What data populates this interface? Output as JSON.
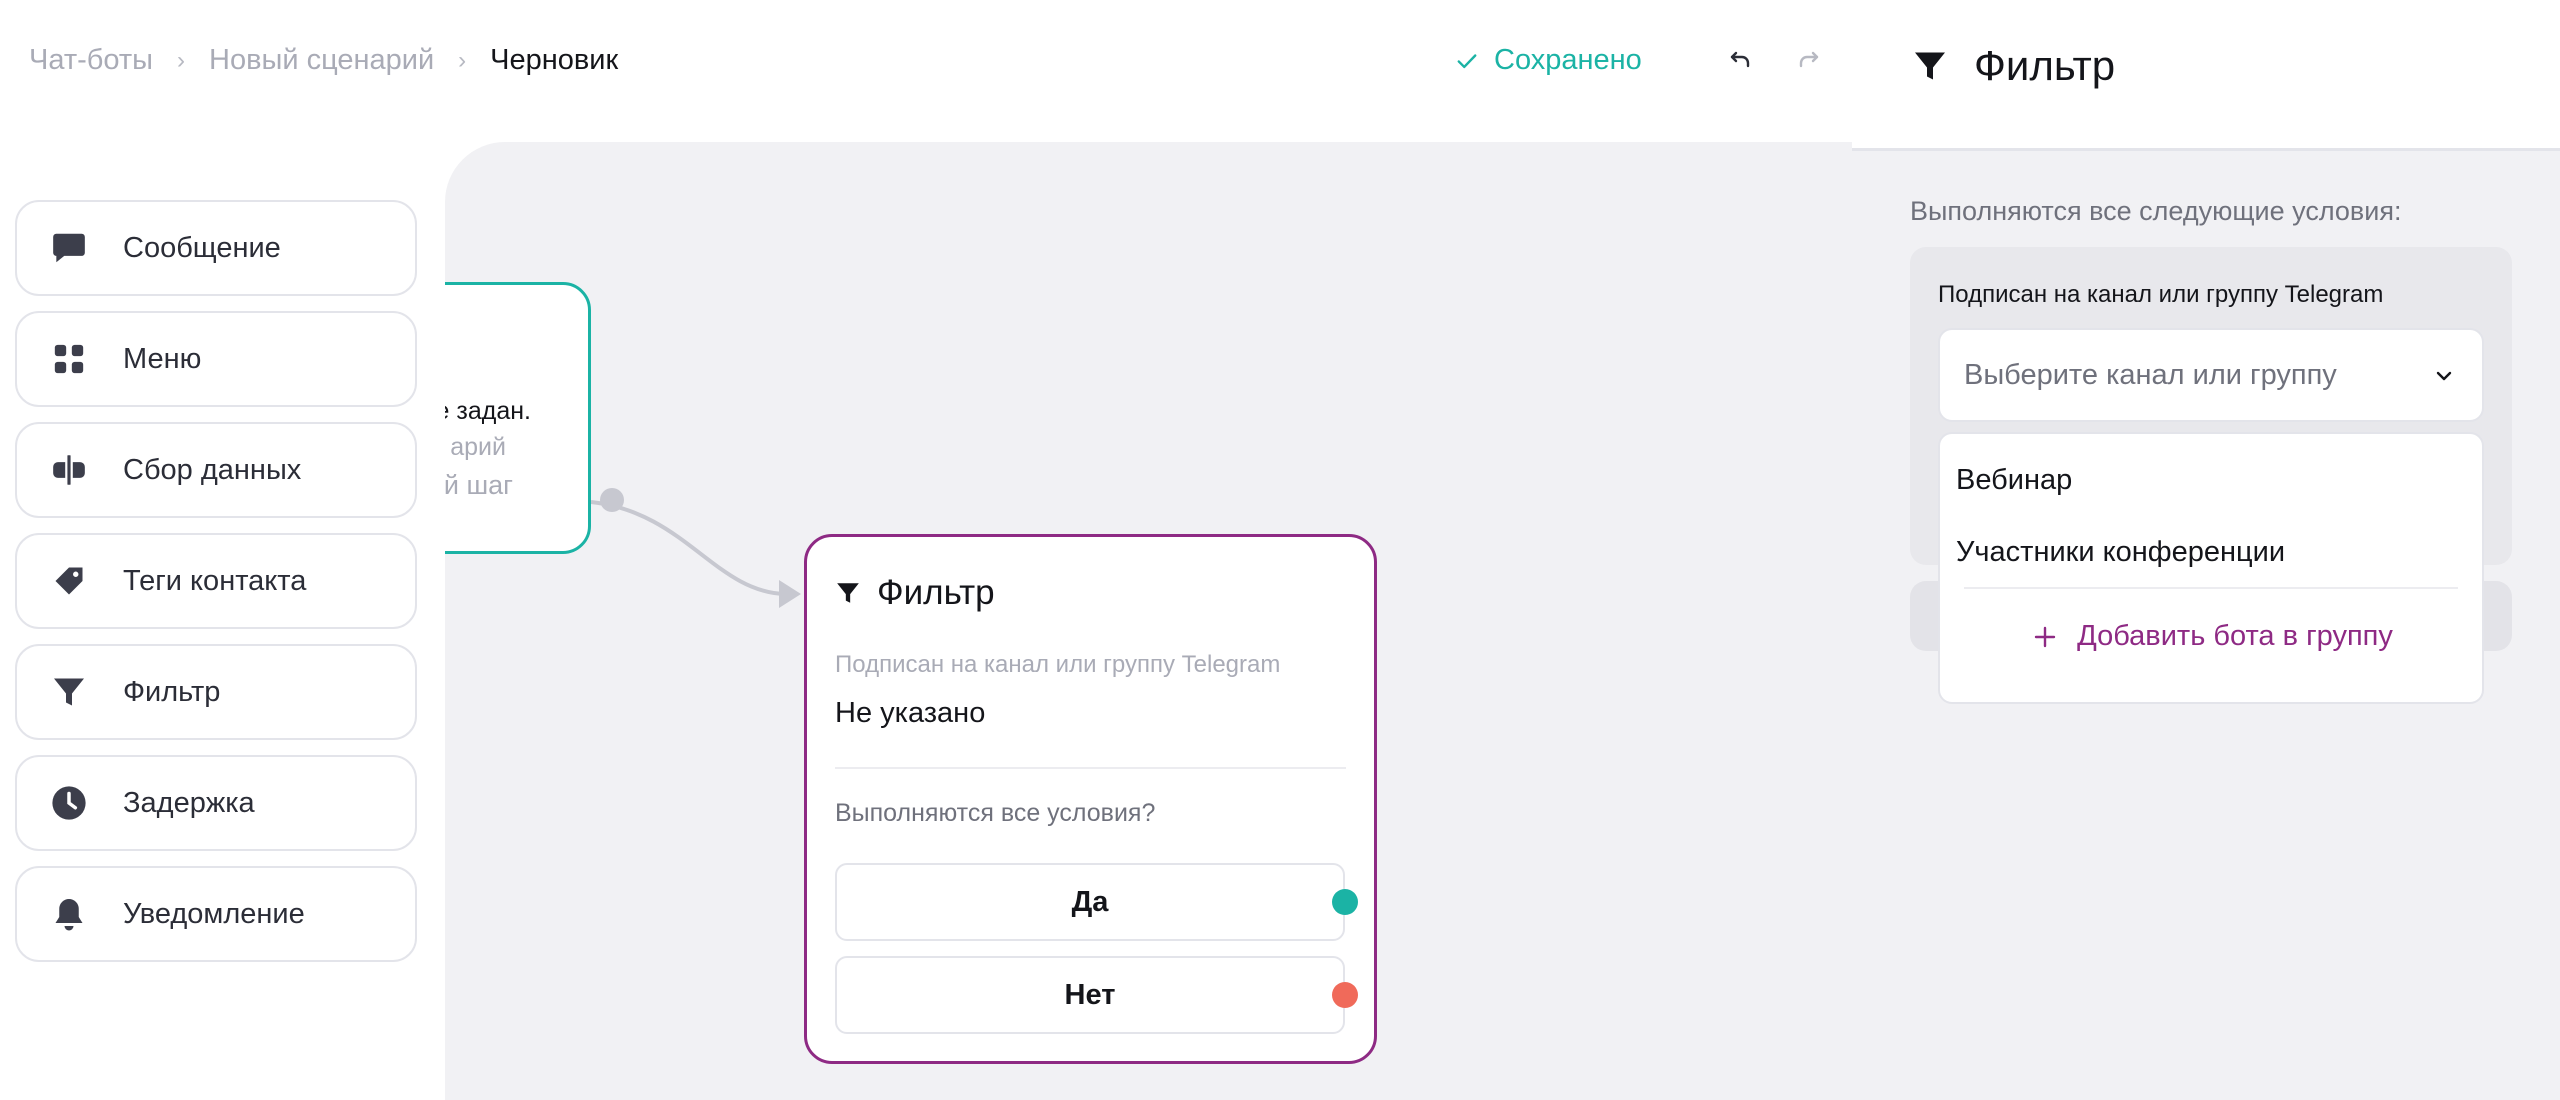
{
  "breadcrumb": {
    "items": [
      "Чат-боты",
      "Новый сценарий",
      "Черновик"
    ],
    "separator": "›"
  },
  "status": {
    "saved_label": "Сохранено",
    "color": "#1bb3a5"
  },
  "toolbar": {
    "undo_icon": "undo-icon",
    "redo_icon": "redo-icon"
  },
  "palette": {
    "items": [
      {
        "label": "Сообщение",
        "icon": "message-icon"
      },
      {
        "label": "Меню",
        "icon": "grid-icon"
      },
      {
        "label": "Сбор данных",
        "icon": "text-cursor-icon"
      },
      {
        "label": "Теги контакта",
        "icon": "tag-icon"
      },
      {
        "label": "Фильтр",
        "icon": "filter-icon"
      },
      {
        "label": "Задержка",
        "icon": "clock-icon"
      },
      {
        "label": "Уведомление",
        "icon": "bell-icon"
      }
    ]
  },
  "canvas": {
    "prev_node": {
      "line1": "е задан.",
      "line2": "арий",
      "line3": "й шаг"
    },
    "filter_node": {
      "title": "Фильтр",
      "condition_label": "Подписан на канал или группу Telegram",
      "condition_value": "Не указано",
      "question": "Выполняются все условия?",
      "yes_label": "Да",
      "no_label": "Нет",
      "accent": "#8e2a84",
      "yes_color": "#1bb3a5",
      "no_color": "#f06a5a"
    }
  },
  "panel": {
    "title": "Фильтр",
    "subtitle": "Выполняются все следующие условия:",
    "condition_title": "Подписан на канал или группу Telegram",
    "select_placeholder": "Выберите канал или группу",
    "options": [
      "Вебинар",
      "Участники конференции"
    ],
    "add_label": "Добавить бота в группу"
  }
}
